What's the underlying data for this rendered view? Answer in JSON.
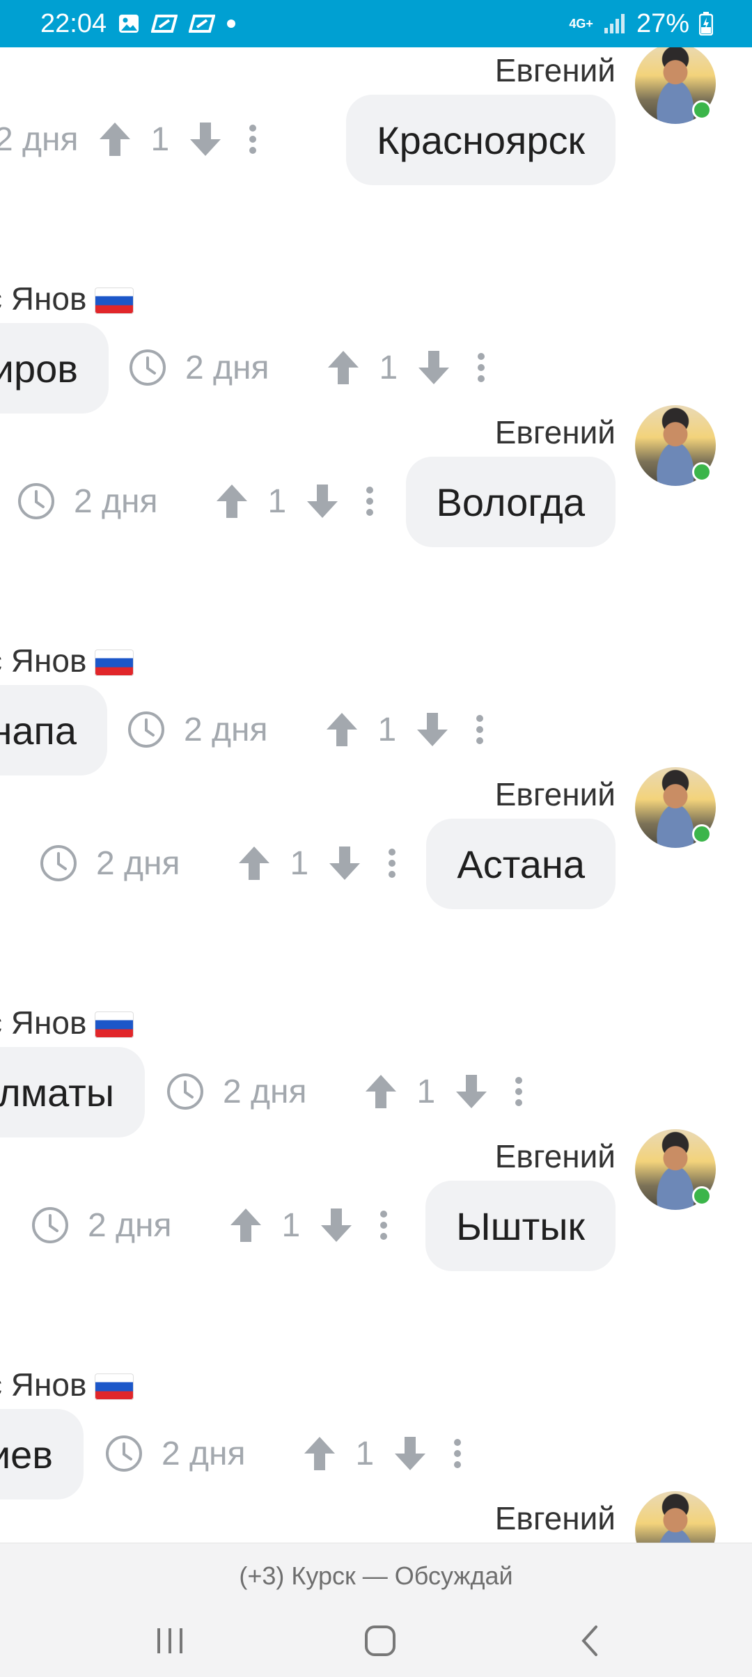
{
  "status_bar": {
    "time": "22:04",
    "network": "4G+",
    "battery": "27%",
    "icons": [
      "gallery-icon",
      "app-notification-icon",
      "app-notification-icon",
      "dot-icon",
      "signal-icon",
      "battery-charging-icon"
    ]
  },
  "messages": [
    {
      "side": "right",
      "author": "Евгений",
      "text": "Красноярск",
      "time": "2 дня",
      "score": "1",
      "online": true
    },
    {
      "side": "left",
      "author": "с Янов",
      "flag": "russia-flag",
      "text": "иров",
      "time": "2 дня",
      "score": "1"
    },
    {
      "side": "right",
      "author": "Евгений",
      "text": "Вологда",
      "time": "2 дня",
      "score": "1",
      "online": true
    },
    {
      "side": "left",
      "author": "с Янов",
      "flag": "russia-flag",
      "text": "напа",
      "time": "2 дня",
      "score": "1"
    },
    {
      "side": "right",
      "author": "Евгений",
      "text": "Астана",
      "time": "2 дня",
      "score": "1",
      "online": true
    },
    {
      "side": "left",
      "author": "с Янов",
      "flag": "russia-flag",
      "text": "лматы",
      "time": "2 дня",
      "score": "1"
    },
    {
      "side": "right",
      "author": "Евгений",
      "text": "Ыштык",
      "time": "2 дня",
      "score": "1",
      "online": true
    },
    {
      "side": "left",
      "author": "с Янов",
      "flag": "russia-flag",
      "text": "иев",
      "time": "2 дня",
      "score": "1"
    },
    {
      "side": "right",
      "author": "Евгений"
    }
  ],
  "bottom_bar": {
    "title": "(+3) Курск — Обсуждай"
  },
  "nav": {
    "icons": [
      "recent-apps-icon",
      "home-icon",
      "back-icon"
    ]
  },
  "colors": {
    "status_bar": "#00a0d2",
    "bubble": "#f1f2f4",
    "meta": "#a3a8ae",
    "online": "#3bb54a"
  }
}
